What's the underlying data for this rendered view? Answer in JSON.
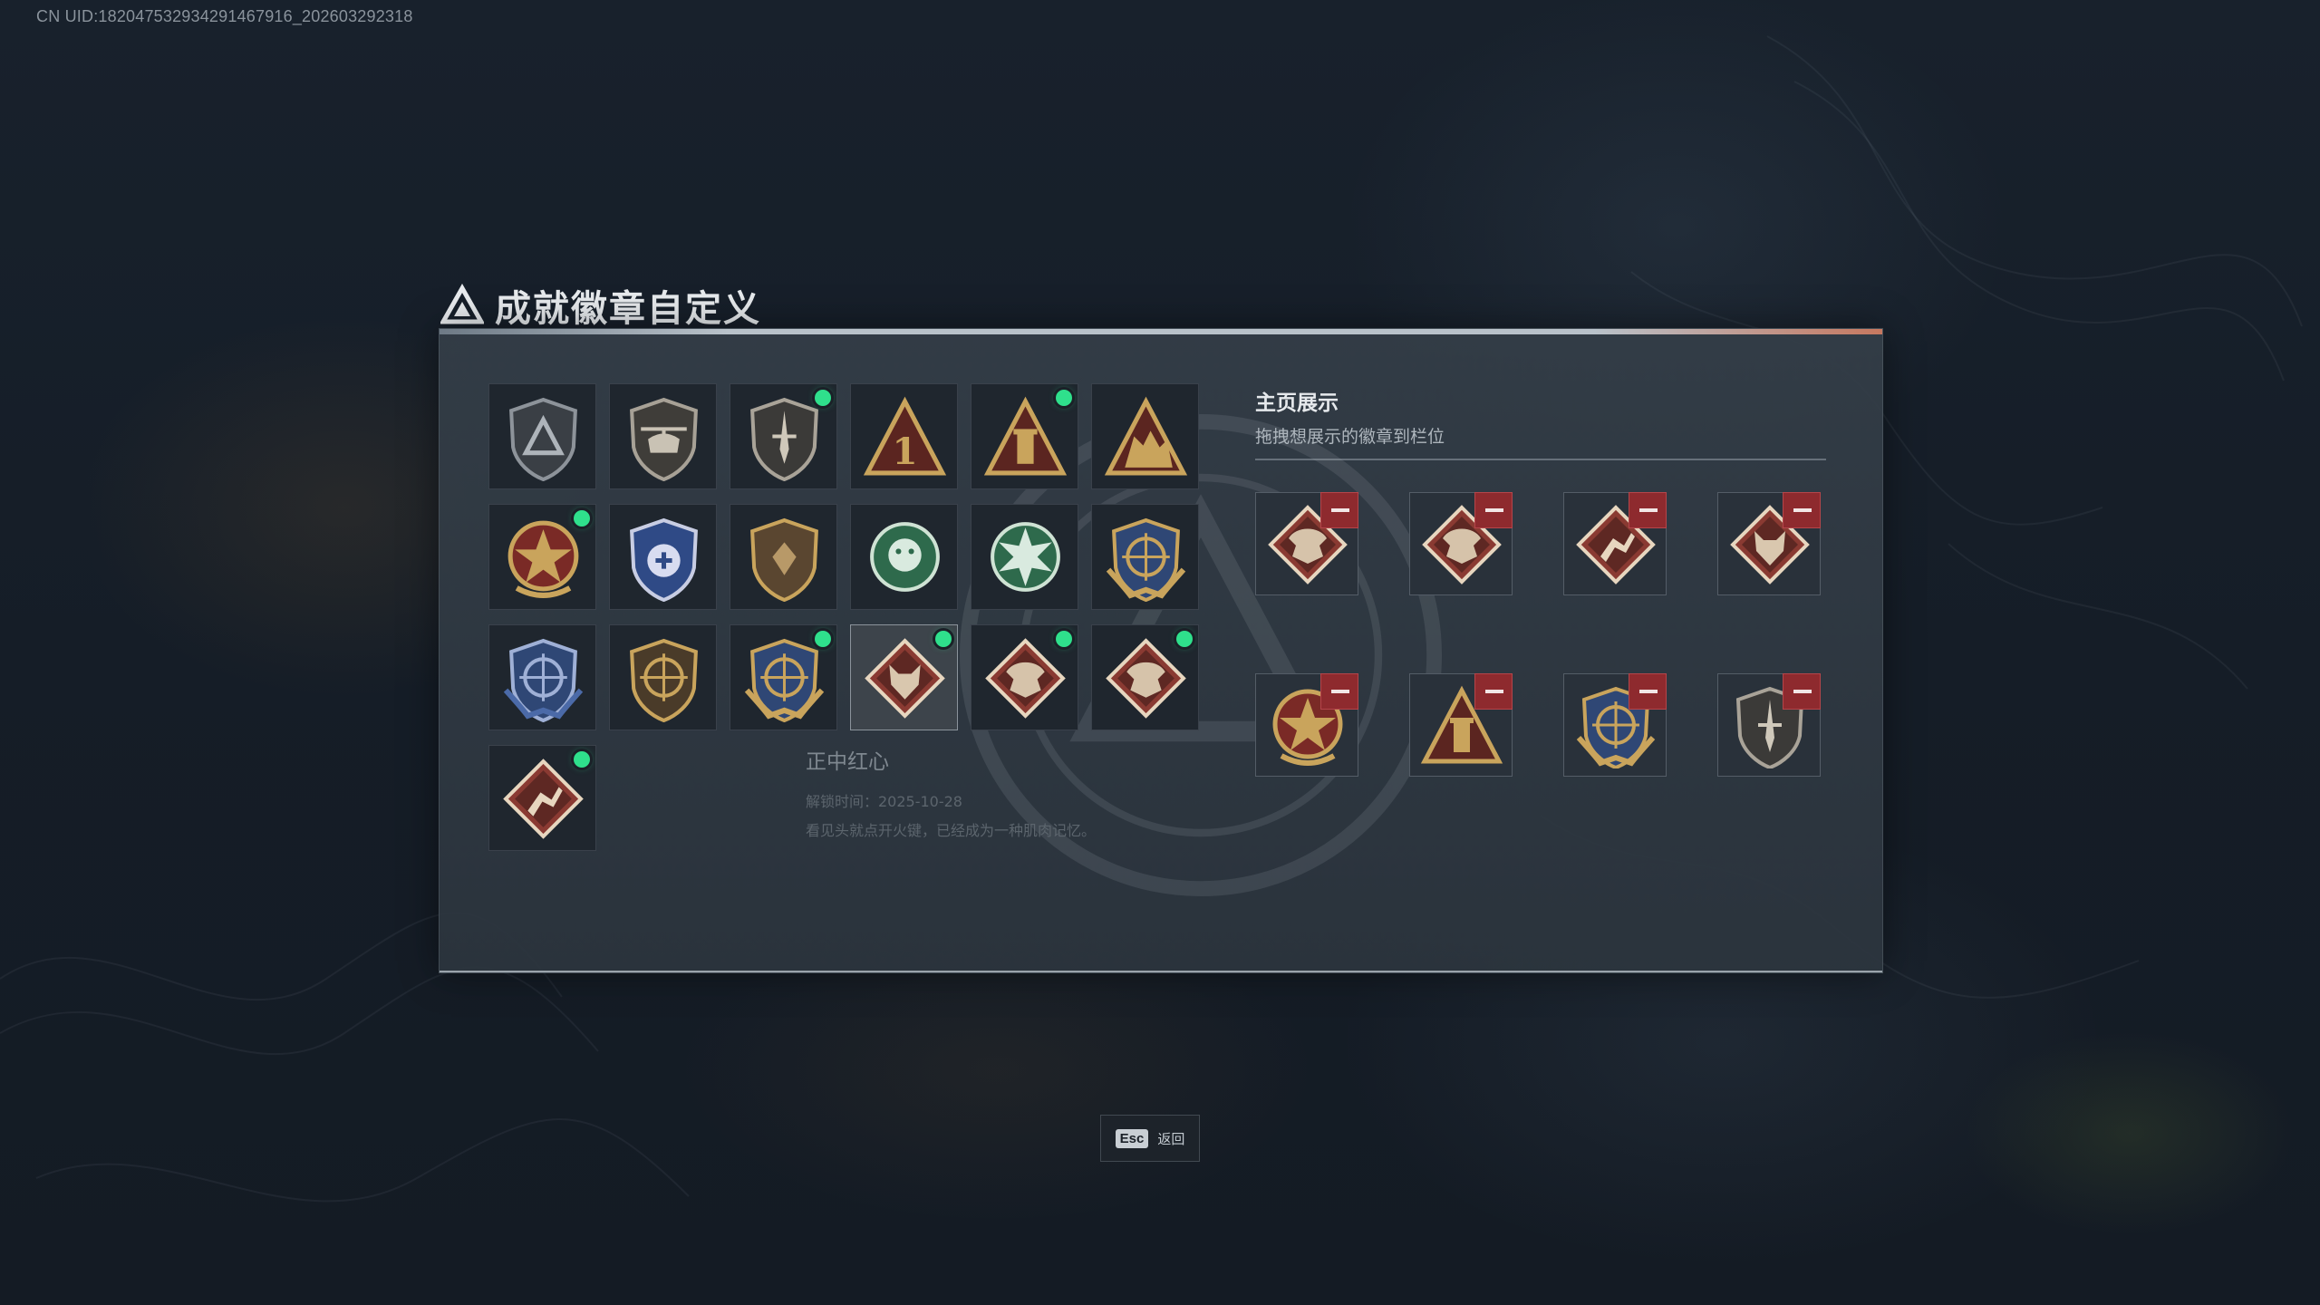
{
  "uid": "CN UID:18204753293429146791​6_202603292318",
  "title": "成就徽章自定义",
  "small_tag": "",
  "grid": {
    "badges": [
      {
        "icon": "triangle-shield-badge-icon",
        "new": false
      },
      {
        "icon": "helicopter-shield-badge-icon",
        "new": false
      },
      {
        "icon": "dagger-shield-badge-icon",
        "new": true
      },
      {
        "icon": "number-one-triangle-badge-icon",
        "new": false
      },
      {
        "icon": "tower-triangle-badge-icon",
        "new": true
      },
      {
        "icon": "soldiers-triangle-badge-icon",
        "new": false
      },
      {
        "icon": "gold-star-medal-badge-icon",
        "new": true
      },
      {
        "icon": "blue-police-badge-icon",
        "new": false
      },
      {
        "icon": "bronze-crest-badge-icon",
        "new": false
      },
      {
        "icon": "green-lion-badge-icon",
        "new": false
      },
      {
        "icon": "green-tank-star-badge-icon",
        "new": false
      },
      {
        "icon": "gold-crosshair-wing-badge-icon",
        "new": false
      },
      {
        "icon": "blue-crosshair-rifle-badge-icon",
        "new": false
      },
      {
        "icon": "gold-crosshair-rifle-badge-icon",
        "new": false
      },
      {
        "icon": "gold-crosshair-wing-badge-icon",
        "new": true
      },
      {
        "icon": "wolf-diamond-badge-icon",
        "new": true,
        "selected": true
      },
      {
        "icon": "dragon-diamond-badge-icon",
        "new": true
      },
      {
        "icon": "dragon-diamond-badge-icon",
        "new": true
      },
      {
        "icon": "runner-diamond-badge-icon",
        "new": true
      }
    ],
    "tooltip": {
      "name": "正中红心",
      "unlock_date": "解锁时间：2025-10-28",
      "description": "看见头就点开火键，已经成为一种肌肉记忆。"
    }
  },
  "display": {
    "title": "主页展示",
    "subtitle": "拖拽想展示的徽章到栏位",
    "slots": [
      {
        "icon": "dragon-diamond-badge-icon"
      },
      {
        "icon": "dragon-diamond-badge-icon"
      },
      {
        "icon": "runner-diamond-badge-icon"
      },
      {
        "icon": "wolf-diamond-badge-icon"
      },
      {
        "icon": "gold-star-medal-badge-icon"
      },
      {
        "icon": "tower-triangle-badge-icon"
      },
      {
        "icon": "gold-crosshair-wing-badge-icon"
      },
      {
        "icon": "dagger-shield-badge-icon"
      }
    ]
  },
  "footer": {
    "esc_key": "Esc",
    "esc_label": "返回"
  },
  "colors": {
    "accent_green": "#2fe08c",
    "remove_red": "#8e2a2e",
    "badge_gold": "#c9a45c",
    "badge_red": "#8a3a32"
  }
}
